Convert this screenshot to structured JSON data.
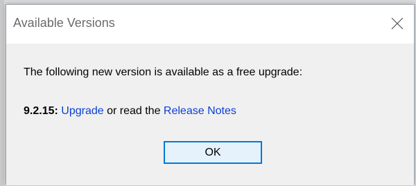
{
  "dialog": {
    "title": "Available Versions",
    "message": "The following new version is available as a free upgrade:",
    "version": "9.2.15:",
    "upgrade_link": "Upgrade",
    "connector_text": " or read the ",
    "release_notes_link": "Release Notes",
    "ok_label": "OK",
    "close_icon": "close-icon"
  },
  "colors": {
    "link": "#0a3fd6",
    "button_border": "#0078d7",
    "button_bg": "#e5f1fb",
    "content_bg": "#f0f0f0"
  }
}
